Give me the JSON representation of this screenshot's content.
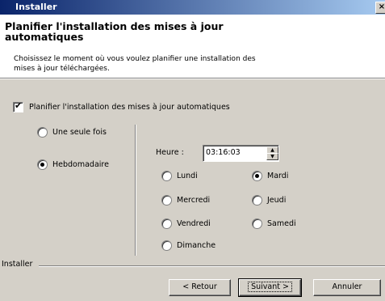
{
  "window": {
    "title": "Installer",
    "close_glyph": "×"
  },
  "header": {
    "title": "Planifier l'installation des mises à jour automatiques",
    "subtitle": "Choisissez le moment où vous voulez planifier une installation des mises à jour téléchargées."
  },
  "schedule_checkbox": {
    "label": "Planifier l'installation des mises à jour automatiques",
    "checked": true,
    "tick": "✔"
  },
  "frequency": {
    "once_label": "Une seule fois",
    "weekly_label": "Hebdomadaire",
    "selected": "Hebdomadaire"
  },
  "time": {
    "label": "Heure :",
    "value": "03:16:03",
    "up_glyph": "▲",
    "down_glyph": "▼"
  },
  "days": {
    "monday": "Lundi",
    "tuesday": "Mardi",
    "wednesday": "Mercredi",
    "thursday": "Jeudi",
    "friday": "Vendredi",
    "saturday": "Samedi",
    "sunday": "Dimanche",
    "selected": "Mardi"
  },
  "footer": {
    "brand": "Installer"
  },
  "buttons": {
    "back": "< Retour",
    "next": "Suivant >",
    "cancel": "Annuler"
  }
}
